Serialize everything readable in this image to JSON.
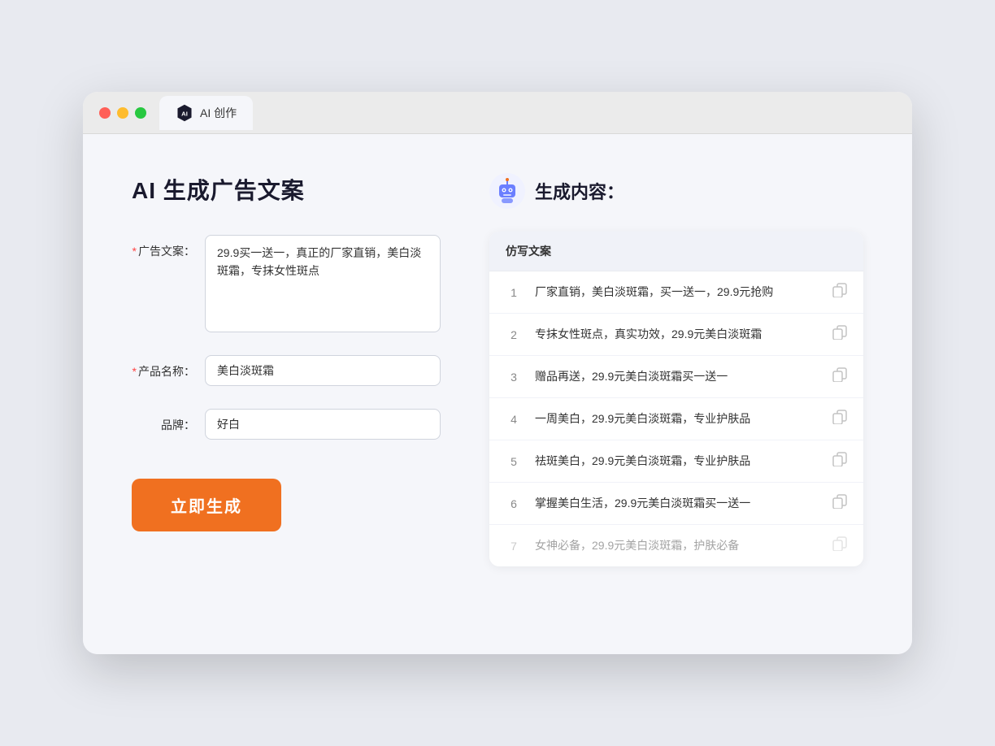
{
  "browser": {
    "tab_label": "AI 创作"
  },
  "left_panel": {
    "title": "AI 生成广告文案",
    "form": {
      "ad_copy_label": "广告文案：",
      "ad_copy_required": "*",
      "ad_copy_value": "29.9买一送一，真正的厂家直销，美白淡斑霜，专抹女性斑点",
      "product_name_label": "产品名称：",
      "product_name_required": "*",
      "product_name_value": "美白淡斑霜",
      "brand_label": "品牌：",
      "brand_value": "好白"
    },
    "generate_button": "立即生成"
  },
  "right_panel": {
    "title": "生成内容：",
    "table_header": "仿写文案",
    "rows": [
      {
        "number": "1",
        "text": "厂家直销，美白淡斑霜，买一送一，29.9元抢购",
        "faded": false
      },
      {
        "number": "2",
        "text": "专抹女性斑点，真实功效，29.9元美白淡斑霜",
        "faded": false
      },
      {
        "number": "3",
        "text": "赠品再送，29.9元美白淡斑霜买一送一",
        "faded": false
      },
      {
        "number": "4",
        "text": "一周美白，29.9元美白淡斑霜，专业护肤品",
        "faded": false
      },
      {
        "number": "5",
        "text": "祛斑美白，29.9元美白淡斑霜，专业护肤品",
        "faded": false
      },
      {
        "number": "6",
        "text": "掌握美白生活，29.9元美白淡斑霜买一送一",
        "faded": false
      },
      {
        "number": "7",
        "text": "女神必备，29.9元美白淡斑霜，护肤必备",
        "faded": true
      }
    ]
  }
}
